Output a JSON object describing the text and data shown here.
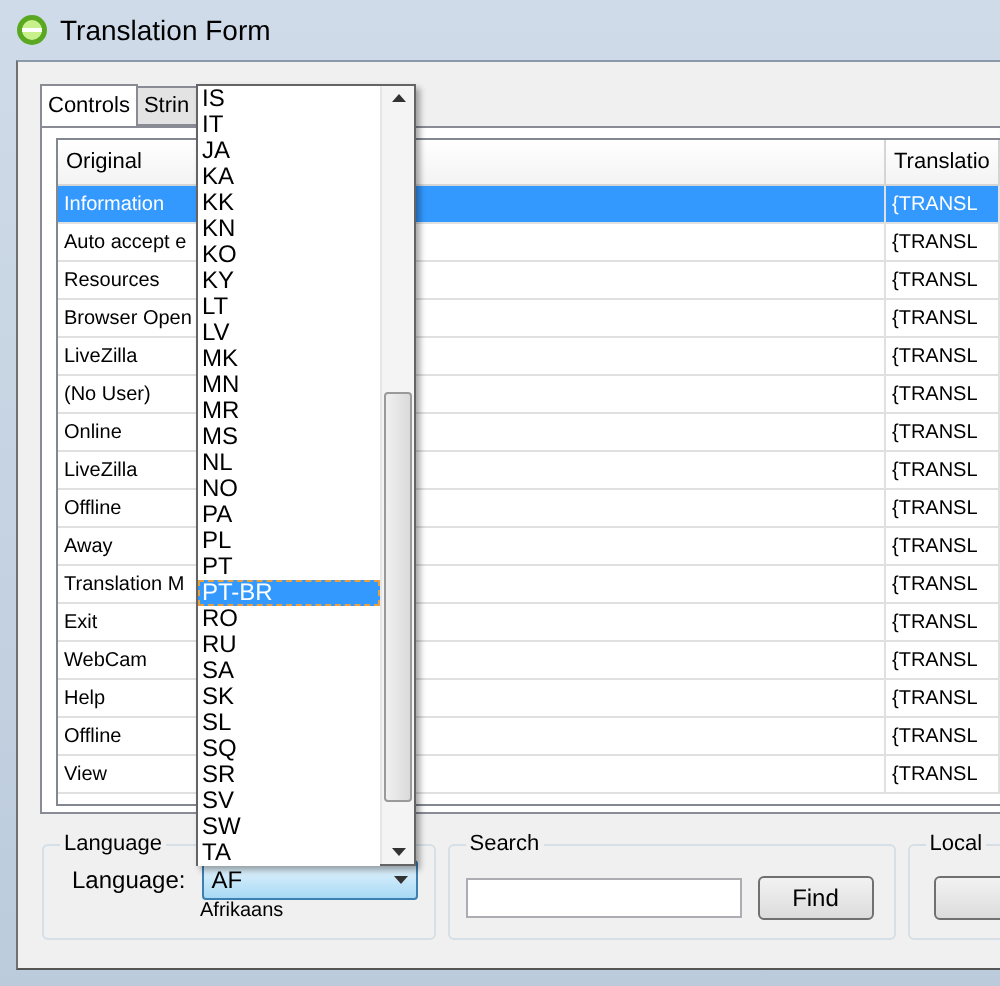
{
  "window": {
    "title": "Translation Form"
  },
  "tabs": [
    {
      "label": "Controls",
      "selected": true
    },
    {
      "label": "Strin",
      "selected": false
    }
  ],
  "table": {
    "columns": [
      "Original",
      "Translatio"
    ],
    "rows": [
      {
        "cells": [
          "Information",
          "{TRANSL"
        ],
        "selected": true
      },
      {
        "cells": [
          "Auto accept e",
          "{TRANSL"
        ],
        "selected": false
      },
      {
        "cells": [
          "Resources",
          "{TRANSL"
        ],
        "selected": false
      },
      {
        "cells": [
          "Browser Open",
          "{TRANSL"
        ],
        "selected": false
      },
      {
        "cells": [
          "LiveZilla",
          "{TRANSL"
        ],
        "selected": false
      },
      {
        "cells": [
          "(No User)",
          "{TRANSL"
        ],
        "selected": false
      },
      {
        "cells": [
          "Online",
          "{TRANSL"
        ],
        "selected": false
      },
      {
        "cells": [
          "LiveZilla",
          "{TRANSL"
        ],
        "selected": false
      },
      {
        "cells": [
          "Offline",
          "{TRANSL"
        ],
        "selected": false
      },
      {
        "cells": [
          "Away",
          "{TRANSL"
        ],
        "selected": false
      },
      {
        "cells": [
          "Translation M",
          "{TRANSL"
        ],
        "selected": false
      },
      {
        "cells": [
          "Exit",
          "{TRANSL"
        ],
        "selected": false
      },
      {
        "cells": [
          "WebCam",
          "{TRANSL"
        ],
        "selected": false
      },
      {
        "cells": [
          "Help",
          "{TRANSL"
        ],
        "selected": false
      },
      {
        "cells": [
          "Offline",
          "{TRANSL"
        ],
        "selected": false
      },
      {
        "cells": [
          "View",
          "{TRANSL"
        ],
        "selected": false
      }
    ]
  },
  "language_group": {
    "title": "Language",
    "label": "Language:",
    "value": "AF",
    "description": "Afrikaans",
    "dropdown": {
      "options": [
        {
          "label": "IS",
          "selected": false
        },
        {
          "label": "IT",
          "selected": false
        },
        {
          "label": "JA",
          "selected": false
        },
        {
          "label": "KA",
          "selected": false
        },
        {
          "label": "KK",
          "selected": false
        },
        {
          "label": "KN",
          "selected": false
        },
        {
          "label": "KO",
          "selected": false
        },
        {
          "label": "KY",
          "selected": false
        },
        {
          "label": "LT",
          "selected": false
        },
        {
          "label": "LV",
          "selected": false
        },
        {
          "label": "MK",
          "selected": false
        },
        {
          "label": "MN",
          "selected": false
        },
        {
          "label": "MR",
          "selected": false
        },
        {
          "label": "MS",
          "selected": false
        },
        {
          "label": "NL",
          "selected": false
        },
        {
          "label": "NO",
          "selected": false
        },
        {
          "label": "PA",
          "selected": false
        },
        {
          "label": "PL",
          "selected": false
        },
        {
          "label": "PT",
          "selected": false
        },
        {
          "label": "PT-BR",
          "selected": true
        },
        {
          "label": "RO",
          "selected": false
        },
        {
          "label": "RU",
          "selected": false
        },
        {
          "label": "SA",
          "selected": false
        },
        {
          "label": "SK",
          "selected": false
        },
        {
          "label": "SL",
          "selected": false
        },
        {
          "label": "SQ",
          "selected": false
        },
        {
          "label": "SR",
          "selected": false
        },
        {
          "label": "SV",
          "selected": false
        },
        {
          "label": "SW",
          "selected": false
        },
        {
          "label": "TA",
          "selected": false
        }
      ]
    }
  },
  "search_group": {
    "title": "Search",
    "button": "Find"
  },
  "local_group": {
    "title": "Local"
  }
}
